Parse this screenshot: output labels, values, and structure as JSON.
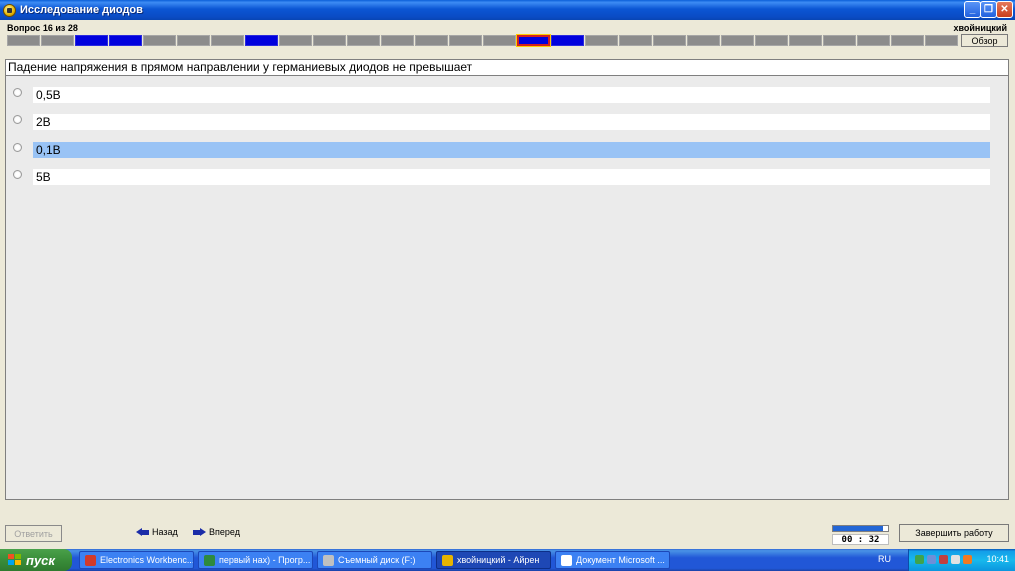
{
  "window": {
    "title": "Исследование диодов"
  },
  "header": {
    "question_counter": "Вопрос 16 из 28",
    "username": "хвойницкий",
    "review_button": "Обзор",
    "progress": {
      "total": 28,
      "current": 16,
      "answered": [
        3,
        4,
        8,
        17
      ]
    }
  },
  "question": {
    "text": "Падение напряжения в прямом направлении у германиевых диодов не превышает",
    "answers": [
      {
        "label": "0,5В",
        "selected": false
      },
      {
        "label": "2В",
        "selected": false
      },
      {
        "label": "0,1В",
        "selected": true
      },
      {
        "label": "5В",
        "selected": false
      }
    ]
  },
  "footer": {
    "answer_button": "Ответить",
    "back_button": "Назад",
    "forward_button": "Вперед",
    "timer_text": "00 : 32",
    "timer_progress": 0.9,
    "finish_button": "Завершить работу"
  },
  "taskbar": {
    "start_label": "пуск",
    "items": [
      {
        "label": "Electronics Workbenc...",
        "icon": "electronics-workbench-icon",
        "color": "#d23a2a"
      },
      {
        "label": "первый нах) - Прогр...",
        "icon": "image-editor-icon",
        "color": "#2e8a3e"
      },
      {
        "label": "Съемный диск (F:)",
        "icon": "removable-disk-icon",
        "color": "#c0c0c0"
      },
      {
        "label": "хвойницкий - Айрен",
        "icon": "test-app-icon",
        "color": "#e6b400",
        "active": true
      },
      {
        "label": "Документ Microsoft ...",
        "icon": "word-document-icon",
        "color": "#ffffff"
      }
    ],
    "language": "RU",
    "clock": "10:41"
  },
  "colors": {
    "selected_answer": "#99c3f5",
    "answered_cell": "#0000dd",
    "unanswered_cell": "#8c8c8c",
    "current_cell_border": "#d22020"
  }
}
